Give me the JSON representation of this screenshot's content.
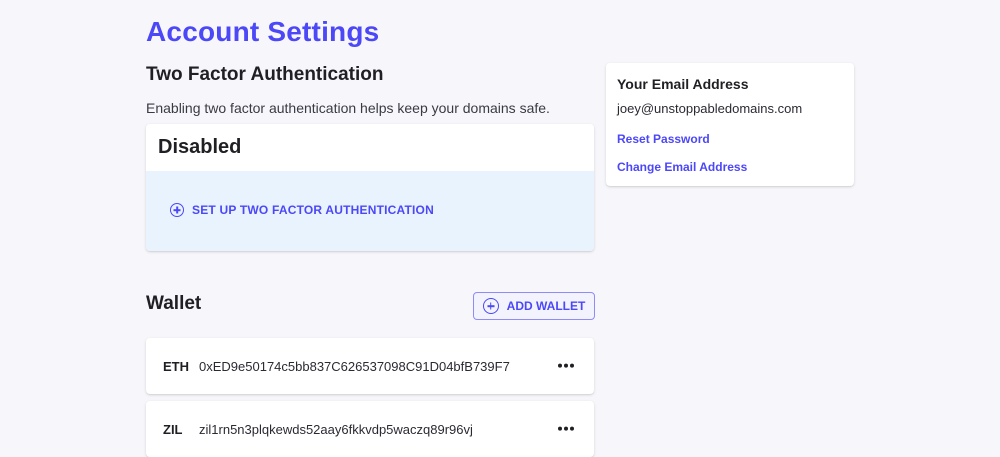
{
  "page": {
    "title": "Account Settings"
  },
  "two_factor": {
    "heading": "Two Factor Authentication",
    "description": "Enabling two factor authentication helps keep your domains safe.",
    "status": "Disabled",
    "setup_label": "SET UP TWO FACTOR AUTHENTICATION"
  },
  "wallet": {
    "heading": "Wallet",
    "add_label": "ADD WALLET",
    "items": [
      {
        "coin": "ETH",
        "address": "0xED9e50174c5bb837C626537098C91D04bfB739F7"
      },
      {
        "coin": "ZIL",
        "address": "zil1rn5n3plqkewds52aay6fkkvdp5waczq89r96vj"
      }
    ]
  },
  "email": {
    "heading": "Your Email Address",
    "address": "joey@unstoppabledomains.com",
    "reset_password_label": "Reset Password",
    "change_email_label": "Change Email Address"
  },
  "colors": {
    "accent": "#4c47f7",
    "tfa_panel_bg": "#e8f3fd",
    "page_bg": "#f7f7fb"
  },
  "icons": {
    "setup": "plus-circle-icon",
    "add_wallet": "plus-circle-icon",
    "row_menu": "more-horizontal-icon"
  }
}
